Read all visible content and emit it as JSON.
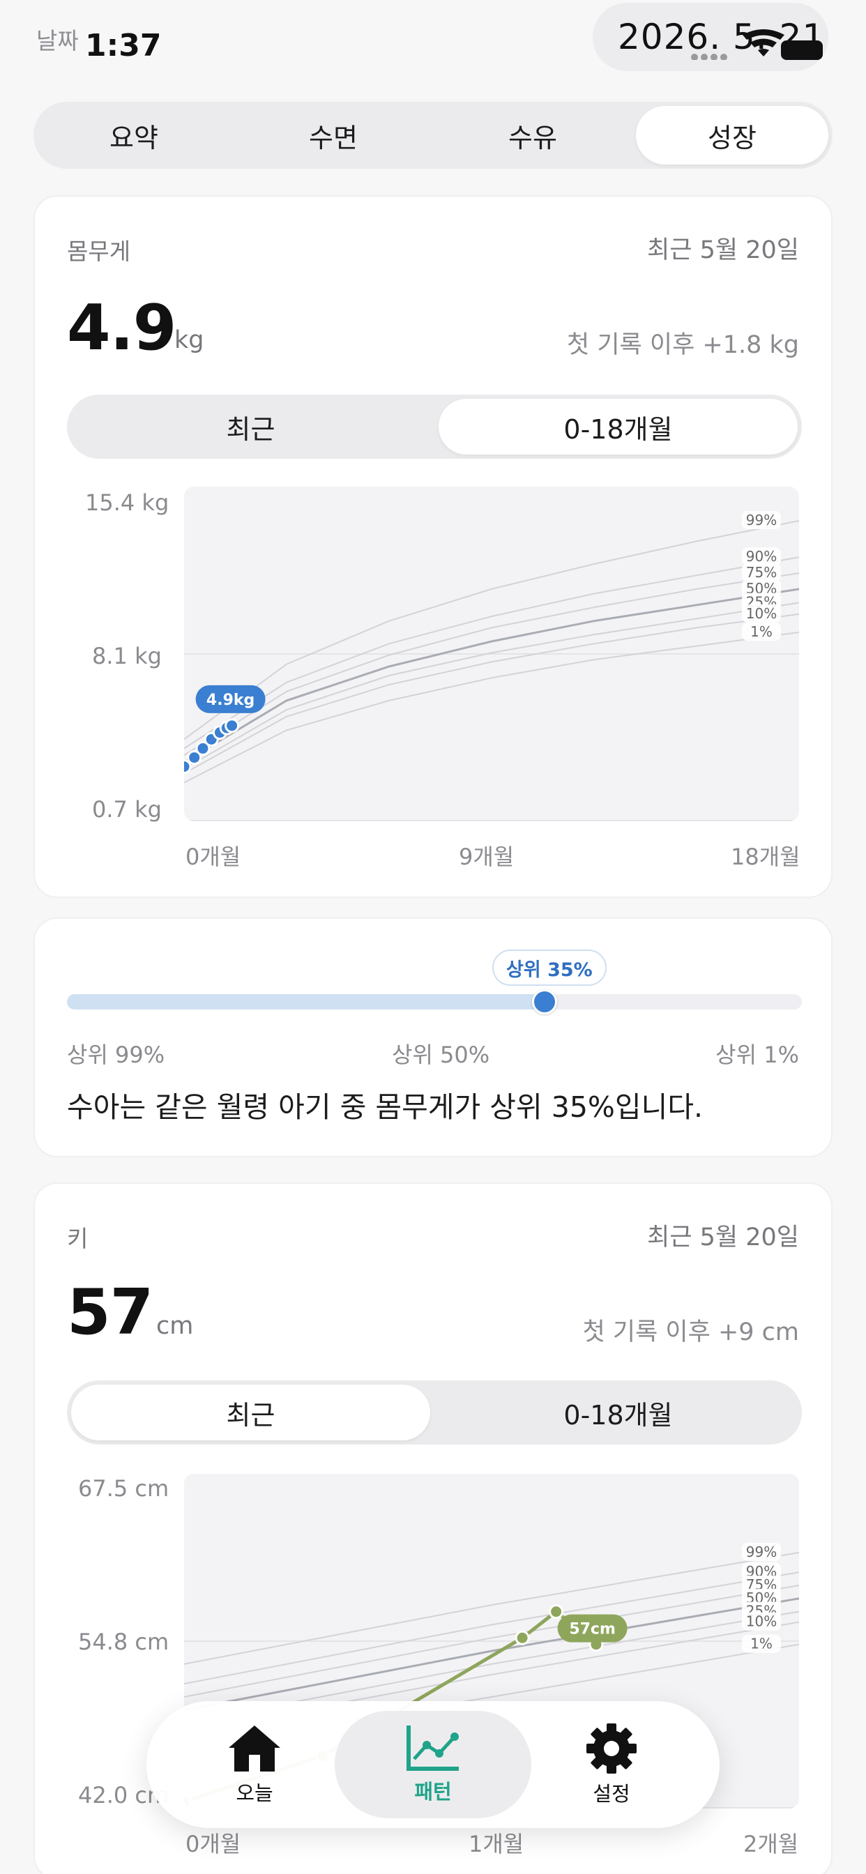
{
  "status": {
    "label": "날짜",
    "time": "1:37",
    "date": "2026. 5. 21"
  },
  "tabs": [
    {
      "label": "요약",
      "active": false
    },
    {
      "label": "수면",
      "active": false
    },
    {
      "label": "수유",
      "active": false
    },
    {
      "label": "성장",
      "active": true
    }
  ],
  "weight": {
    "label": "몸무게",
    "latest": "최근 5월 20일",
    "value": "4.9",
    "unit": "kg",
    "delta": "첫 기록 이후 +1.8 kg",
    "range_tabs": [
      {
        "label": "최근",
        "active": false
      },
      {
        "label": "0-18개월",
        "active": true
      }
    ],
    "y_ticks": [
      "15.4 kg",
      "8.1 kg",
      "0.7 kg"
    ],
    "x_ticks": [
      "0개월",
      "9개월",
      "18개월"
    ],
    "point_label": "4.9kg"
  },
  "percentile": {
    "value": 35,
    "bubble": "상위 35%",
    "left_label": "상위 99%",
    "mid_label": "상위 50%",
    "right_label": "상위 1%",
    "sentence": "수아는 같은 월령 아기 중 몸무게가 상위 35%입니다."
  },
  "height": {
    "label": "키",
    "latest": "최근 5월 20일",
    "value": "57",
    "unit": "cm",
    "delta": "첫 기록 이후 +9 cm",
    "range_tabs": [
      {
        "label": "최근",
        "active": true
      },
      {
        "label": "0-18개월",
        "active": false
      }
    ],
    "y_ticks": [
      "67.5 cm",
      "54.8 cm",
      "42.0 cm"
    ],
    "x_ticks": [
      "0개월",
      "1개월",
      "2개월"
    ],
    "point_label": "57cm"
  },
  "nav": [
    {
      "label": "오늘",
      "icon": "house-icon",
      "active": false
    },
    {
      "label": "패턴",
      "icon": "chart-line-icon",
      "active": true
    },
    {
      "label": "설정",
      "icon": "gear-icon",
      "active": false
    }
  ],
  "chart_data": [
    {
      "type": "line",
      "title": "몸무게",
      "xlabel": "",
      "ylabel": "",
      "x_range": [
        0,
        18
      ],
      "x_unit": "개월",
      "ylim": [
        0.7,
        15.4
      ],
      "y_unit": "kg",
      "percentile_curves": [
        {
          "name": "99%",
          "values": [
            [
              0,
              4.3
            ],
            [
              3,
              7.6
            ],
            [
              6,
              9.5
            ],
            [
              9,
              10.9
            ],
            [
              12,
              12.0
            ],
            [
              15,
              13.0
            ],
            [
              18,
              13.9
            ]
          ]
        },
        {
          "name": "90%",
          "values": [
            [
              0,
              3.9
            ],
            [
              3,
              6.8
            ],
            [
              6,
              8.5
            ],
            [
              9,
              9.7
            ],
            [
              12,
              10.7
            ],
            [
              15,
              11.5
            ],
            [
              18,
              12.3
            ]
          ]
        },
        {
          "name": "75%",
          "values": [
            [
              0,
              3.6
            ],
            [
              3,
              6.4
            ],
            [
              6,
              8.0
            ],
            [
              9,
              9.2
            ],
            [
              12,
              10.1
            ],
            [
              15,
              10.9
            ],
            [
              18,
              11.6
            ]
          ]
        },
        {
          "name": "50%",
          "values": [
            [
              0,
              3.3
            ],
            [
              3,
              6.0
            ],
            [
              6,
              7.5
            ],
            [
              9,
              8.6
            ],
            [
              12,
              9.5
            ],
            [
              15,
              10.2
            ],
            [
              18,
              10.9
            ]
          ]
        },
        {
          "name": "25%",
          "values": [
            [
              0,
              3.0
            ],
            [
              3,
              5.6
            ],
            [
              6,
              7.1
            ],
            [
              9,
              8.1
            ],
            [
              12,
              8.9
            ],
            [
              15,
              9.6
            ],
            [
              18,
              10.3
            ]
          ]
        },
        {
          "name": "10%",
          "values": [
            [
              0,
              2.8
            ],
            [
              3,
              5.3
            ],
            [
              6,
              6.7
            ],
            [
              9,
              7.7
            ],
            [
              12,
              8.5
            ],
            [
              15,
              9.2
            ],
            [
              18,
              9.8
            ]
          ]
        },
        {
          "name": "1%",
          "values": [
            [
              0,
              2.4
            ],
            [
              3,
              4.7
            ],
            [
              6,
              6.0
            ],
            [
              9,
              7.0
            ],
            [
              12,
              7.8
            ],
            [
              15,
              8.4
            ],
            [
              18,
              9.0
            ]
          ]
        }
      ],
      "series": [
        {
          "name": "",
          "values": [
            [
              0.0,
              3.1
            ],
            [
              0.3,
              3.5
            ],
            [
              0.55,
              3.9
            ],
            [
              0.8,
              4.3
            ],
            [
              1.05,
              4.6
            ],
            [
              1.25,
              4.8
            ],
            [
              1.4,
              4.9
            ]
          ]
        }
      ],
      "annotations": [
        "4.9kg"
      ]
    },
    {
      "type": "line",
      "title": "키",
      "xlabel": "",
      "ylabel": "",
      "x_range": [
        0,
        2
      ],
      "x_unit": "개월",
      "ylim": [
        42.0,
        67.5
      ],
      "y_unit": "cm",
      "percentile_curves": [
        {
          "name": "99%",
          "values": [
            [
              0,
              53.0
            ],
            [
              1,
              57.5
            ],
            [
              2,
              61.5
            ]
          ]
        },
        {
          "name": "90%",
          "values": [
            [
              0,
              51.5
            ],
            [
              1,
              56.0
            ],
            [
              2,
              60.0
            ]
          ]
        },
        {
          "name": "75%",
          "values": [
            [
              0,
              50.5
            ],
            [
              1,
              55.0
            ],
            [
              2,
              59.0
            ]
          ]
        },
        {
          "name": "50%",
          "values": [
            [
              0,
              49.5
            ],
            [
              1,
              54.0
            ],
            [
              2,
              58.0
            ]
          ]
        },
        {
          "name": "25%",
          "values": [
            [
              0,
              48.5
            ],
            [
              1,
              53.0
            ],
            [
              2,
              57.0
            ]
          ]
        },
        {
          "name": "10%",
          "values": [
            [
              0,
              47.8
            ],
            [
              1,
              52.2
            ],
            [
              2,
              56.2
            ]
          ]
        },
        {
          "name": "1%",
          "values": [
            [
              0,
              46.5
            ],
            [
              1,
              50.5
            ],
            [
              2,
              54.5
            ]
          ]
        }
      ],
      "series": [
        {
          "name": "",
          "values": [
            [
              0.0,
              42.5
            ],
            [
              0.45,
              46.0
            ],
            [
              1.1,
              55.0
            ],
            [
              1.21,
              57.0
            ],
            [
              1.34,
              54.5
            ]
          ]
        }
      ],
      "annotations": [
        "57cm"
      ]
    }
  ]
}
